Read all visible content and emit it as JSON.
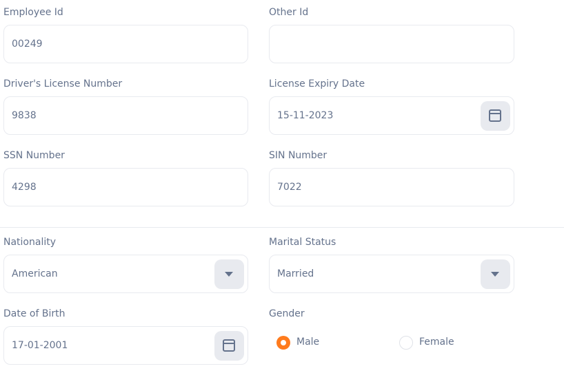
{
  "employee_id": {
    "label": "Employee Id",
    "value": "00249"
  },
  "other_id": {
    "label": "Other Id",
    "value": ""
  },
  "drivers_license": {
    "label": "Driver's License Number",
    "value": "9838"
  },
  "license_expiry": {
    "label": "License Expiry Date",
    "value": "15-11-2023"
  },
  "ssn": {
    "label": "SSN Number",
    "value": "4298"
  },
  "sin": {
    "label": "SIN Number",
    "value": "7022"
  },
  "nationality": {
    "label": "Nationality",
    "value": "American"
  },
  "marital_status": {
    "label": "Marital Status",
    "value": "Married"
  },
  "date_of_birth": {
    "label": "Date of Birth",
    "value": "17-01-2001"
  },
  "gender": {
    "label": "Gender",
    "options": [
      {
        "label": "Male",
        "selected": true
      },
      {
        "label": "Female",
        "selected": false
      }
    ]
  },
  "colors": {
    "accent": "#ff7b1d",
    "text": "#64728c",
    "border": "#e8eaef"
  },
  "icons": {
    "date_picker": "calendar-icon",
    "dropdown": "caret-down-icon"
  }
}
